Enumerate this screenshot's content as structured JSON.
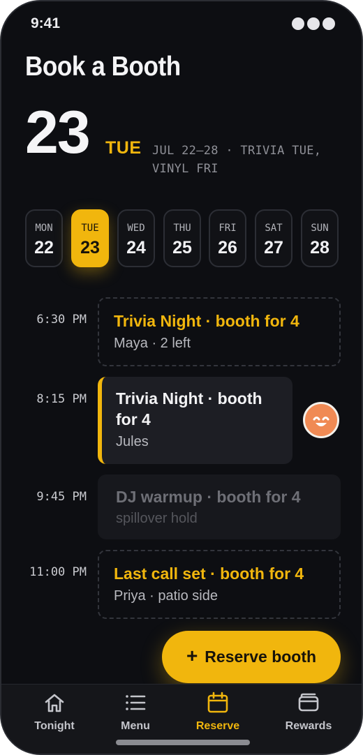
{
  "status": {
    "time": "9:41"
  },
  "header": {
    "title": "Book a Booth",
    "day_number": "23",
    "day_of_week": "TUE",
    "week_info": "JUL 22–28 · TRIVIA TUE, VINYL FRI"
  },
  "days": [
    {
      "dow": "MON",
      "num": "22",
      "selected": false
    },
    {
      "dow": "TUE",
      "num": "23",
      "selected": true
    },
    {
      "dow": "WED",
      "num": "24",
      "selected": false
    },
    {
      "dow": "THU",
      "num": "25",
      "selected": false
    },
    {
      "dow": "FRI",
      "num": "26",
      "selected": false
    },
    {
      "dow": "SAT",
      "num": "27",
      "selected": false
    },
    {
      "dow": "SUN",
      "num": "28",
      "selected": false
    }
  ],
  "slots": [
    {
      "time": "6:30 PM",
      "title": "Trivia Night · booth for 4",
      "subtitle": "Maya · 2 left",
      "state": "open"
    },
    {
      "time": "8:15 PM",
      "title": "Trivia Night · booth for 4",
      "subtitle": "Jules",
      "state": "booked"
    },
    {
      "time": "9:45 PM",
      "title": "DJ warmup · booth for 4",
      "subtitle": "spillover hold",
      "state": "hold"
    },
    {
      "time": "11:00 PM",
      "title": "Last call set · booth for 4",
      "subtitle": "Priya · patio side",
      "state": "open"
    }
  ],
  "fab": {
    "label": "Reserve booth"
  },
  "tabs": [
    {
      "label": "Tonight",
      "icon": "home-icon",
      "active": false
    },
    {
      "label": "Menu",
      "icon": "list-icon",
      "active": false
    },
    {
      "label": "Reserve",
      "icon": "calendar-icon",
      "active": true
    },
    {
      "label": "Rewards",
      "icon": "wallet-icon",
      "active": false
    }
  ],
  "colors": {
    "accent": "#f1b60d",
    "background": "#0d0e12",
    "card": "#1d1e24",
    "avatar": "#f08a54"
  }
}
